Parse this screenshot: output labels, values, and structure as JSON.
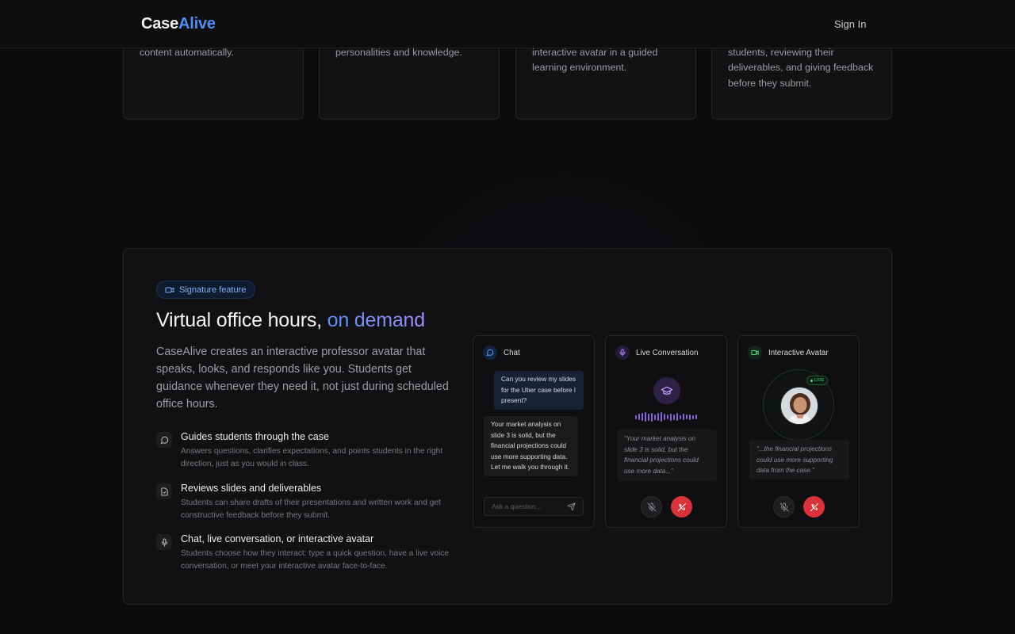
{
  "header": {
    "logo_part1": "Case",
    "logo_part2": "Alive",
    "sign_in": "Sign In"
  },
  "top_cards": [
    {
      "text": "Our AI converts it to structured content automatically."
    },
    {
      "text": "to life as AI personas with distinct personalities and knowledge."
    },
    {
      "text": "through chat, live conversation, or interactive avatar in a guided learning environment."
    },
    {
      "text": "always available: guiding students, reviewing their deliverables, and giving feedback before they submit."
    }
  ],
  "feature": {
    "badge": "Signature feature",
    "title_main": "Virtual office hours, ",
    "title_accent": "on demand",
    "description": "CaseAlive creates an interactive professor avatar that speaks, looks, and responds like you. Students get guidance whenever they need it, not just during scheduled office hours.",
    "items": [
      {
        "icon": "chat-bubble-icon",
        "title": "Guides students through the case",
        "text": "Answers questions, clarifies expectations, and points students in the right direction, just as you would in class."
      },
      {
        "icon": "document-icon",
        "title": "Reviews slides and deliverables",
        "text": "Students can share drafts of their presentations and written work and get constructive feedback before they submit."
      },
      {
        "icon": "microphone-icon",
        "title": "Chat, live conversation, or interactive avatar",
        "text": "Students choose how they interact: type a quick question, have a live voice conversation, or meet your interactive avatar face-to-face."
      }
    ]
  },
  "modes": {
    "chat": {
      "title": "Chat",
      "user_message": "Can you review my slides for the Uber case before I present?",
      "ai_message": "Your market analysis on slide 3 is solid, but the financial projections could use more supporting data. Let me walk you through it.",
      "input_placeholder": "Ask a question..."
    },
    "live": {
      "title": "Live Conversation",
      "caption": "“Your market analysis on slide 3 is solid, but the financial projections could use more data...”"
    },
    "avatar": {
      "title": "Interactive Avatar",
      "live_badge": "LIVE",
      "caption": "“...the financial projections could use more supporting data from the case.”"
    }
  },
  "colors": {
    "brand_blue": "#4f8ef7",
    "accent_purple": "#a78bfa",
    "end_call_red": "#d8333a",
    "live_green": "#4ade80"
  }
}
